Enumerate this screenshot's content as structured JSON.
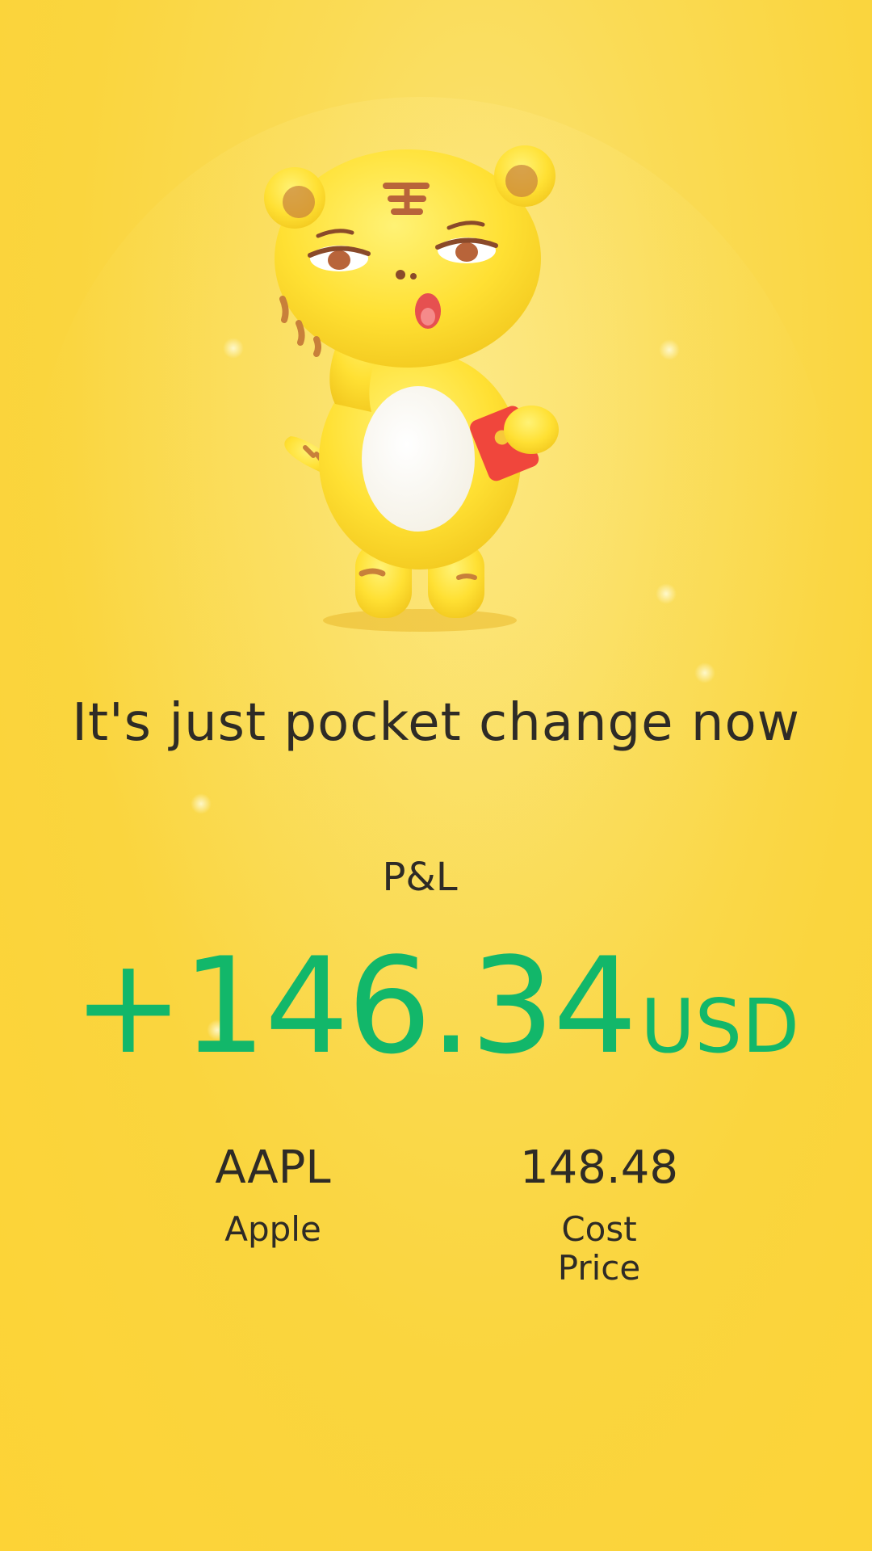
{
  "headline": "It's just pocket change now",
  "pnl": {
    "label": "P&L",
    "amount": "+146.34",
    "currency": "USD",
    "color": "#12B76A"
  },
  "stock": {
    "symbol": "AAPL",
    "name": "Apple"
  },
  "cost": {
    "value": "148.48",
    "label": "Cost Price"
  },
  "mascot": {
    "icon": "tiger-mascot-holding-red-envelope",
    "body_color": "#FFE033",
    "envelope_color": "#F0463C"
  }
}
